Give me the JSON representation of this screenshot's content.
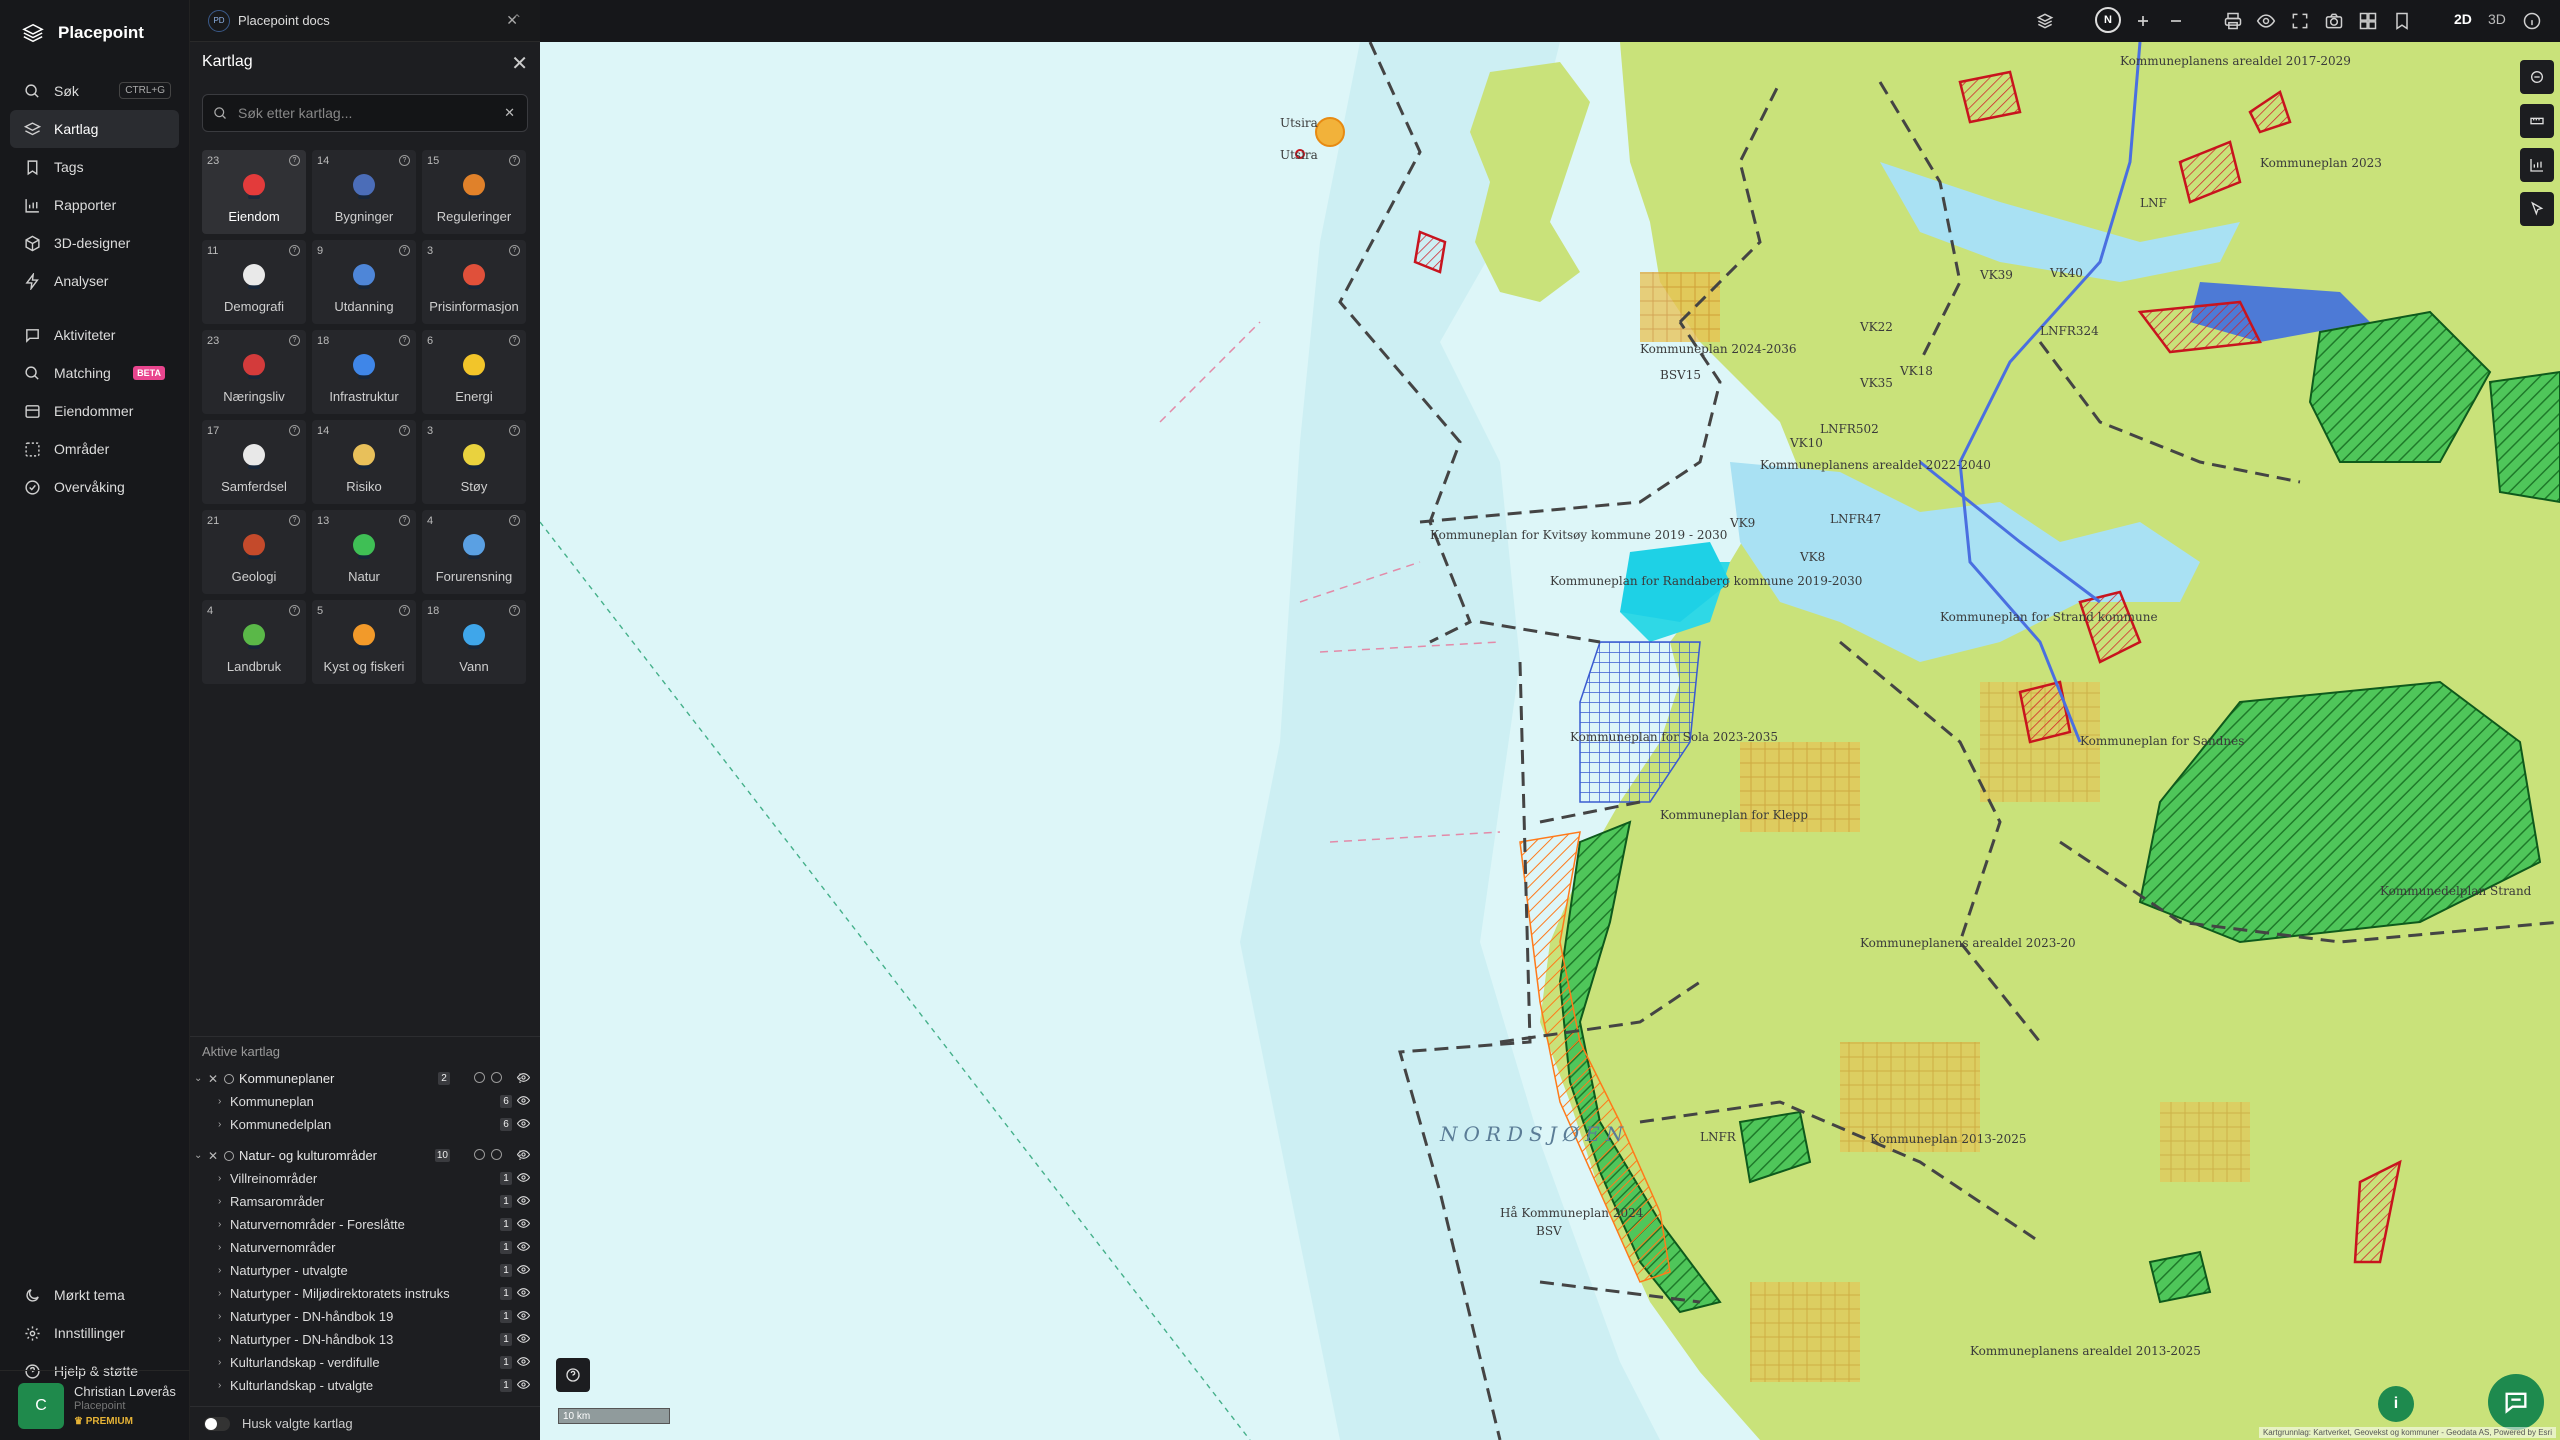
{
  "brand": {
    "name": "Placepoint"
  },
  "nav": {
    "items": [
      {
        "label": "Søk",
        "shortcut": "CTRL+G"
      },
      {
        "label": "Kartlag"
      },
      {
        "label": "Tags"
      },
      {
        "label": "Rapporter"
      },
      {
        "label": "3D-designer"
      },
      {
        "label": "Analyser"
      },
      {
        "label": "Aktiviteter"
      },
      {
        "label": "Matching",
        "badge": "BETA"
      },
      {
        "label": "Eiendommer"
      },
      {
        "label": "Områder"
      },
      {
        "label": "Overvåking"
      }
    ],
    "bottom": [
      {
        "label": "Mørkt tema"
      },
      {
        "label": "Innstillinger"
      },
      {
        "label": "Hjelp & støtte"
      }
    ]
  },
  "user": {
    "initial": "C",
    "name": "Christian Løverås",
    "org": "Placepoint",
    "plan": "PREMIUM"
  },
  "tab": {
    "badge": "PD",
    "title": "Placepoint docs"
  },
  "panel": {
    "title": "Kartlag",
    "search_placeholder": "Søk etter kartlag...",
    "tiles": [
      {
        "count": "23",
        "label": "Eiendom",
        "icon": "pin-icon"
      },
      {
        "count": "14",
        "label": "Bygninger",
        "icon": "building-icon"
      },
      {
        "count": "15",
        "label": "Reguleringer",
        "icon": "signpost-icon"
      },
      {
        "count": "11",
        "label": "Demografi",
        "icon": "people-chart-icon"
      },
      {
        "count": "9",
        "label": "Utdanning",
        "icon": "graduation-cap-icon"
      },
      {
        "count": "3",
        "label": "Prisinformasjon",
        "icon": "shopping-bag-icon"
      },
      {
        "count": "23",
        "label": "Næringsliv",
        "icon": "briefcase-icon"
      },
      {
        "count": "18",
        "label": "Infrastruktur",
        "icon": "globe-icon"
      },
      {
        "count": "6",
        "label": "Energi",
        "icon": "lightning-icon"
      },
      {
        "count": "17",
        "label": "Samferdsel",
        "icon": "bus-icon"
      },
      {
        "count": "14",
        "label": "Risiko",
        "icon": "hazard-icon"
      },
      {
        "count": "3",
        "label": "Støy",
        "icon": "noise-gauge-icon"
      },
      {
        "count": "21",
        "label": "Geologi",
        "icon": "terrain-icon"
      },
      {
        "count": "13",
        "label": "Natur",
        "icon": "leaf-icon"
      },
      {
        "count": "4",
        "label": "Forurensning",
        "icon": "factory-icon"
      },
      {
        "count": "4",
        "label": "Landbruk",
        "icon": "sprout-icon"
      },
      {
        "count": "5",
        "label": "Kyst og fiskeri",
        "icon": "fish-icon"
      },
      {
        "count": "18",
        "label": "Vann",
        "icon": "water-drop-icon"
      }
    ]
  },
  "active_layers": {
    "title": "Aktive kartlag",
    "groups": [
      {
        "name": "Kommuneplaner",
        "count": "2",
        "layers": [
          {
            "name": "Kommuneplan",
            "count": "6"
          },
          {
            "name": "Kommunedelplan",
            "count": "6"
          }
        ]
      },
      {
        "name": "Natur- og kulturområder",
        "count": "10",
        "layers": [
          {
            "name": "Villreinområder",
            "count": "1"
          },
          {
            "name": "Ramsarområder",
            "count": "1"
          },
          {
            "name": "Naturvernområder - Foreslåtte",
            "count": "1"
          },
          {
            "name": "Naturvernområder",
            "count": "1"
          },
          {
            "name": "Naturtyper - utvalgte",
            "count": "1"
          },
          {
            "name": "Naturtyper - Miljødirektoratets instruks",
            "count": "1"
          },
          {
            "name": "Naturtyper - DN-håndbok 19",
            "count": "1"
          },
          {
            "name": "Naturtyper - DN-håndbok 13",
            "count": "1"
          },
          {
            "name": "Kulturlandskap - verdifulle",
            "count": "1"
          },
          {
            "name": "Kulturlandskap - utvalgte",
            "count": "1"
          }
        ]
      }
    ],
    "remember_label": "Husk valgte kartlag"
  },
  "toolbar": {
    "compass": "N",
    "mode_2d": "2D",
    "mode_3d": "3D",
    "active_mode": "2D"
  },
  "map": {
    "scale": "10 km",
    "sea_label": "NORDSJØEN",
    "labels": [
      "Utsira",
      "Utsira",
      "Kommuneplan 2024-2036",
      "BSV15",
      "Kommuneplan for Kvitsøy kommune 2019 - 2030",
      "Kommuneplan for Randaberg kommune 2019-2030",
      "Kommuneplanens arealdel 2022-2040",
      "Kommuneplan for Sola 2023-2035",
      "Kommuneplan for Klepp",
      "Hå Kommuneplan 2024",
      "BSV",
      "Kommuneplan 2013-2025",
      "Kommuneplanens arealdel 2023-20",
      "Kommuneplan for Sandnes",
      "Kommunedelplan Strand",
      "Kommuneplanens arealdel 2013-2025",
      "Kommuneplanens arealdel 2017-2029",
      "VK39",
      "VK40",
      "VK22",
      "VK18",
      "VK35",
      "VK10",
      "VK9",
      "VK8",
      "LNFR324",
      "LNFR502",
      "LNFR47",
      "LNF",
      "LNFR",
      "Kommuneplan 2023",
      "Kommuneplan for Strand kommune"
    ],
    "attribution": "Kartgrunnlag: Kartverket, Geovekst og kommuner - Geodata AS, Powered by Esri"
  }
}
